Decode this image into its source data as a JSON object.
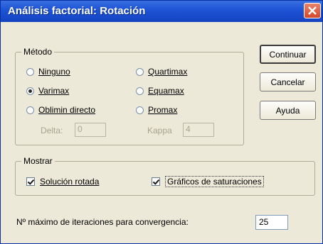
{
  "window": {
    "title": "Análisis factorial: Rotación"
  },
  "metodo": {
    "label": "Método",
    "options": [
      {
        "label": "Ninguno",
        "selected": false
      },
      {
        "label": "Varimax",
        "selected": true
      },
      {
        "label": "Oblimin directo",
        "selected": false
      },
      {
        "label": "Quartimax",
        "selected": false
      },
      {
        "label": "Equamax",
        "selected": false
      },
      {
        "label": "Promax",
        "selected": false
      }
    ],
    "delta_label": "Delta:",
    "delta_value": "0",
    "kappa_label": "Kappa",
    "kappa_value": "4"
  },
  "mostrar": {
    "label": "Mostrar",
    "solucion_rotada": {
      "label": "Solución rotada",
      "checked": true
    },
    "graficos_saturaciones": {
      "label": "Gráficos de saturaciones",
      "checked": true
    }
  },
  "iteraciones": {
    "label": "Nº máximo de iteraciones para convergencia:",
    "value": "25"
  },
  "buttons": {
    "continuar": "Continuar",
    "cancelar": "Cancelar",
    "ayuda": "Ayuda"
  }
}
